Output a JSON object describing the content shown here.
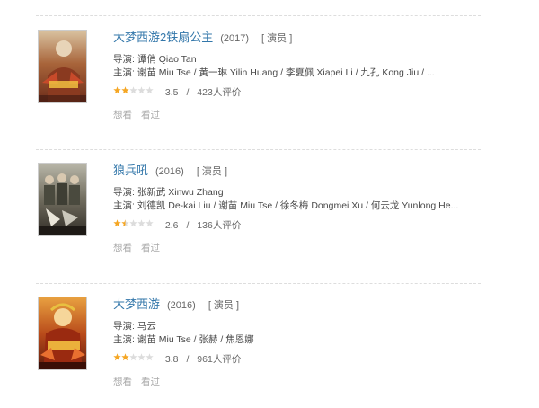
{
  "films": [
    {
      "title": "大梦西游2铁扇公主",
      "year": "(2017)",
      "role": "[ 演员 ]",
      "director": "导演: 谭俏 Qiao Tan",
      "cast": "主演: 谢苗 Miu Tse / 黄一琳 Yilin Huang / 李夏佩 Xiapei Li / 九孔 Kong Jiu / ...",
      "score": "3.5",
      "count": "423人评价",
      "rating_sep": "/",
      "stars": 2,
      "half": false,
      "want": "想看",
      "seen": "看过"
    },
    {
      "title": "狼兵吼",
      "year": "(2016)",
      "role": "[ 演员 ]",
      "director": "导演: 张新武 Xinwu Zhang",
      "cast": "主演: 刘德凯 De-kai Liu / 谢苗 Miu Tse / 徐冬梅 Dongmei Xu / 何云龙 Yunlong He...",
      "score": "2.6",
      "count": "136人评价",
      "rating_sep": "/",
      "stars": 1,
      "half": true,
      "want": "想看",
      "seen": "看过"
    },
    {
      "title": "大梦西游",
      "year": "(2016)",
      "role": "[ 演员 ]",
      "director": "导演: 马云",
      "cast": "主演: 谢苗 Miu Tse / 张赫 / 焦恩娜",
      "score": "3.8",
      "count": "961人评价",
      "rating_sep": "/",
      "stars": 2,
      "half": false,
      "want": "想看",
      "seen": "看过"
    }
  ],
  "colors": {
    "link": "#3377aa",
    "star_on": "#f5a623",
    "star_off": "#dcdcdc",
    "muted": "#aaaaaa"
  }
}
